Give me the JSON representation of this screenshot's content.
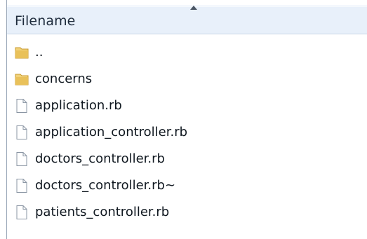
{
  "header": {
    "column_label": "Filename"
  },
  "files": [
    {
      "name": "..",
      "icon": "folder-icon"
    },
    {
      "name": "concerns",
      "icon": "folder-icon"
    },
    {
      "name": "application.rb",
      "icon": "file-icon"
    },
    {
      "name": "application_controller.rb",
      "icon": "file-icon"
    },
    {
      "name": "doctors_controller.rb",
      "icon": "file-icon"
    },
    {
      "name": "doctors_controller.rb~",
      "icon": "file-icon"
    },
    {
      "name": "patients_controller.rb",
      "icon": "file-icon"
    }
  ],
  "colors": {
    "header_bg": "#e8f0fa",
    "folder": "#e9c15a",
    "file_outline": "#8a95a3"
  }
}
